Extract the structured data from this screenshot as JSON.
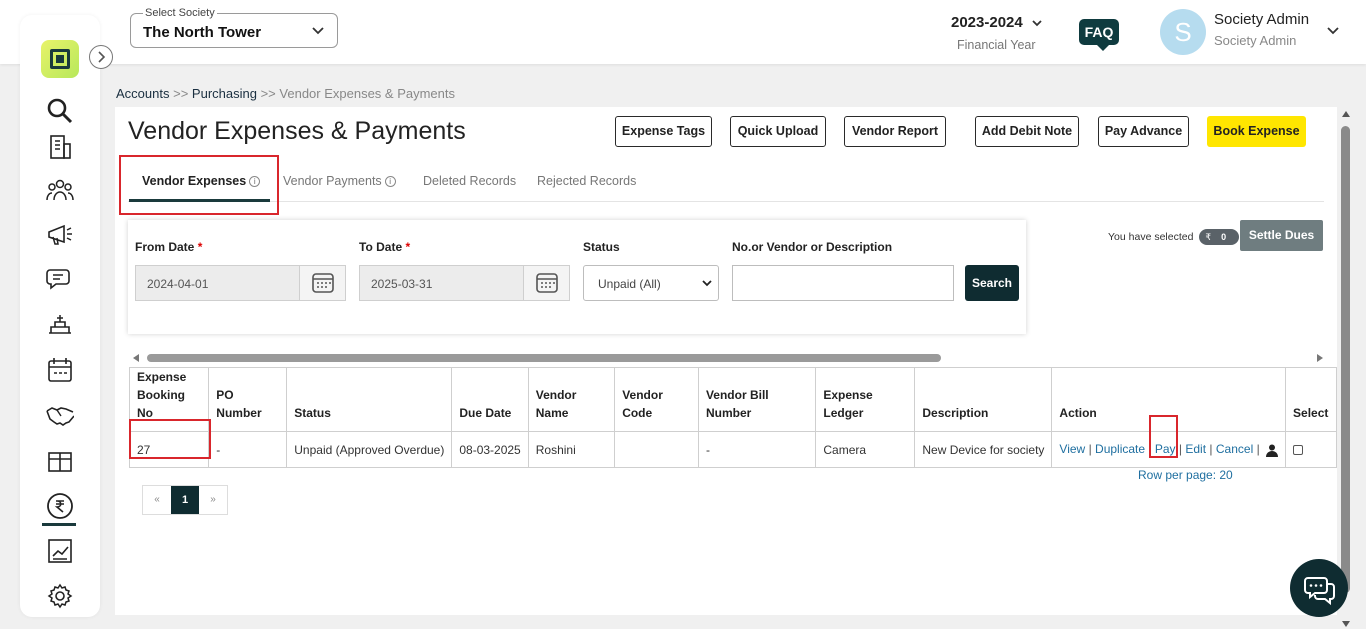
{
  "header": {
    "society_label": "Select Society",
    "society_value": "The North Tower",
    "fy_year": "2023-2024",
    "fy_label": "Financial Year",
    "faq": "FAQ",
    "avatar_initial": "S",
    "user_name": "Society Admin",
    "user_role": "Society Admin"
  },
  "sidebar": {
    "icons": [
      "search-icon",
      "building-icon",
      "members-icon",
      "announcement-icon",
      "chat-icon",
      "facility-icon",
      "calendar-icon",
      "handshake-icon",
      "parcel-icon",
      "rupee-icon",
      "report-chart-icon",
      "settings-icon"
    ],
    "active": "rupee-icon"
  },
  "breadcrumb": {
    "accounts": "Accounts",
    "sep1": ">>",
    "purchasing": "Purchasing",
    "sep2": ">>",
    "current": "Vendor Expenses & Payments"
  },
  "page": {
    "title": "Vendor Expenses & Payments",
    "buttons": {
      "expense_tags": "Expense Tags",
      "quick_upload": "Quick Upload",
      "vendor_report": "Vendor Report",
      "add_debit_note": "Add Debit Note",
      "pay_advance": "Pay Advance",
      "book_expense": "Book Expense"
    },
    "tabs": {
      "vendor_expenses": "Vendor Expenses",
      "vendor_payments": "Vendor Payments",
      "deleted_records": "Deleted Records",
      "rejected_records": "Rejected Records"
    }
  },
  "filters": {
    "from_date_label": "From Date",
    "from_date_value": "2024-04-01",
    "to_date_label": "To Date",
    "to_date_value": "2025-03-31",
    "status_label": "Status",
    "status_value": "Unpaid (All)",
    "search_label": "No.or Vendor or Description",
    "search_value": "",
    "search_button": "Search",
    "required_mark": "*"
  },
  "selection": {
    "text": "You have selected",
    "currency": "₹",
    "count": "0",
    "settle_button": "Settle Dues"
  },
  "table": {
    "headers": [
      "Expense Booking No",
      "PO Number",
      "Status",
      "Due Date",
      "Vendor Name",
      "Vendor Code",
      "Vendor Bill Number",
      "Expense Ledger",
      "Description",
      "Action",
      "Select"
    ],
    "rows": [
      {
        "booking_no": "27",
        "po_number": "-",
        "status": "Unpaid (Approved Overdue)",
        "due_date": "08-03-2025",
        "vendor_name": "Roshini",
        "vendor_code": "",
        "vendor_bill_number": "-",
        "expense_ledger": "Camera",
        "description": "New Device for society",
        "actions": {
          "view": "View",
          "duplicate": "Duplicate",
          "pay": "Pay",
          "edit": "Edit",
          "cancel": "Cancel",
          "sep": "|"
        },
        "selected": false
      }
    ]
  },
  "pagination": {
    "prev": "«",
    "current": "1",
    "next": "»",
    "rows_per_page": "Row per page: 20"
  },
  "colors": {
    "primary_dark": "#0f2c31",
    "accent_yellow": "#ffe600",
    "highlight_red": "#d9262c",
    "link_blue": "#1f6fa0"
  }
}
